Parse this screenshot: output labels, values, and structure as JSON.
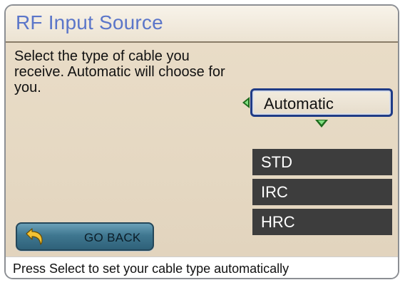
{
  "screen": {
    "title": "RF Input Source",
    "description": "Select the type of cable you receive.  Automatic will choose for you."
  },
  "selector": {
    "value": "Automatic"
  },
  "options": [
    {
      "label": "STD"
    },
    {
      "label": "IRC"
    },
    {
      "label": "HRC"
    }
  ],
  "go_back": {
    "label": "GO BACK",
    "icon": "back-arrow-icon"
  },
  "status": {
    "text": "Press Select to set your cable type automatically"
  },
  "colors": {
    "title": "#5b76c9",
    "selector_border": "#1f3b86",
    "option_bg": "#3d3d3d",
    "arrow": "#1d6b1d",
    "go_back_bg": "#3f7790"
  }
}
